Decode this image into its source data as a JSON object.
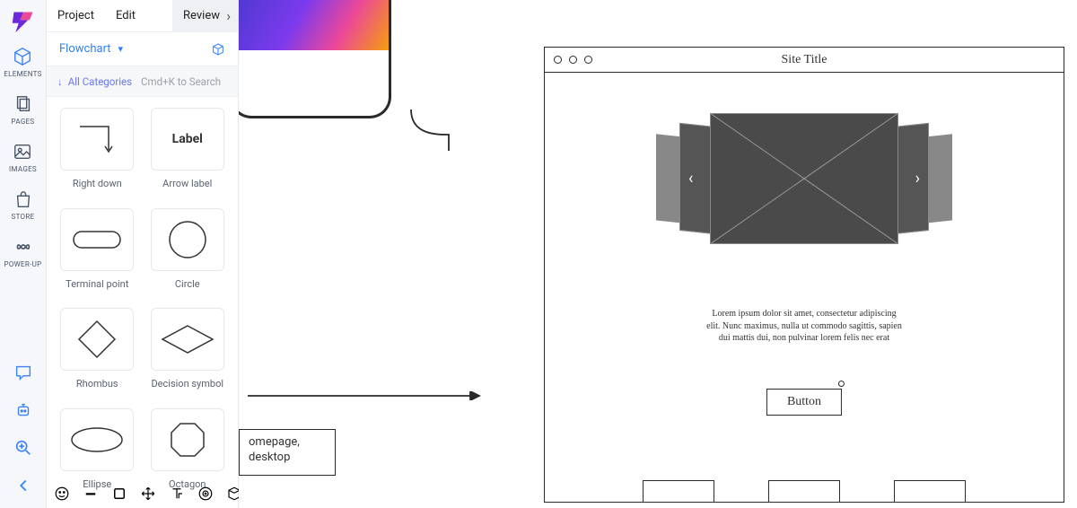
{
  "rail": {
    "items": [
      {
        "label": "ELEMENTS"
      },
      {
        "label": "PAGES"
      },
      {
        "label": "IMAGES"
      },
      {
        "label": "STORE"
      },
      {
        "label": "POWER-UP"
      }
    ]
  },
  "menu": {
    "project": "Project",
    "edit": "Edit",
    "review": "Review"
  },
  "panel": {
    "title": "Flowchart",
    "all_categories": "All Categories",
    "search_hint": "Cmd+K to Search"
  },
  "shapes": {
    "s0": {
      "label": "Right down"
    },
    "s1": {
      "label": "Arrow label",
      "content": "Label"
    },
    "s2": {
      "label": "Terminal point"
    },
    "s3": {
      "label": "Circle"
    },
    "s4": {
      "label": "Rhombus"
    },
    "s5": {
      "label": "Decision symbol"
    },
    "s6": {
      "label": "Ellipse"
    },
    "s7": {
      "label": "Octagon"
    }
  },
  "canvas": {
    "homepage_text": "omepage, desktop"
  },
  "mockup": {
    "site_title": "Site Title",
    "lorem": "Lorem ipsum dolor sit amet, consectetur adipiscing elit. Nunc maximus, nulla ut commodo sagittis, sapien dui mattis dui, non pulvinar lorem felis nec erat",
    "button": "Button"
  }
}
